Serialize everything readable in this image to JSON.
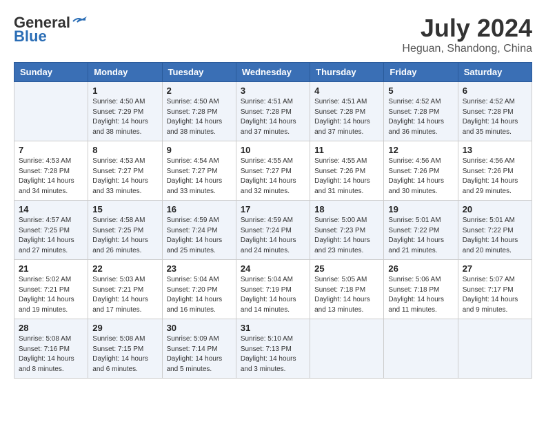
{
  "header": {
    "logo_line1": "General",
    "logo_line2": "Blue",
    "month_year": "July 2024",
    "location": "Heguan, Shandong, China"
  },
  "weekdays": [
    "Sunday",
    "Monday",
    "Tuesday",
    "Wednesday",
    "Thursday",
    "Friday",
    "Saturday"
  ],
  "weeks": [
    [
      {
        "day": "",
        "info": ""
      },
      {
        "day": "1",
        "info": "Sunrise: 4:50 AM\nSunset: 7:29 PM\nDaylight: 14 hours\nand 38 minutes."
      },
      {
        "day": "2",
        "info": "Sunrise: 4:50 AM\nSunset: 7:28 PM\nDaylight: 14 hours\nand 38 minutes."
      },
      {
        "day": "3",
        "info": "Sunrise: 4:51 AM\nSunset: 7:28 PM\nDaylight: 14 hours\nand 37 minutes."
      },
      {
        "day": "4",
        "info": "Sunrise: 4:51 AM\nSunset: 7:28 PM\nDaylight: 14 hours\nand 37 minutes."
      },
      {
        "day": "5",
        "info": "Sunrise: 4:52 AM\nSunset: 7:28 PM\nDaylight: 14 hours\nand 36 minutes."
      },
      {
        "day": "6",
        "info": "Sunrise: 4:52 AM\nSunset: 7:28 PM\nDaylight: 14 hours\nand 35 minutes."
      }
    ],
    [
      {
        "day": "7",
        "info": "Sunrise: 4:53 AM\nSunset: 7:28 PM\nDaylight: 14 hours\nand 34 minutes."
      },
      {
        "day": "8",
        "info": "Sunrise: 4:53 AM\nSunset: 7:27 PM\nDaylight: 14 hours\nand 33 minutes."
      },
      {
        "day": "9",
        "info": "Sunrise: 4:54 AM\nSunset: 7:27 PM\nDaylight: 14 hours\nand 33 minutes."
      },
      {
        "day": "10",
        "info": "Sunrise: 4:55 AM\nSunset: 7:27 PM\nDaylight: 14 hours\nand 32 minutes."
      },
      {
        "day": "11",
        "info": "Sunrise: 4:55 AM\nSunset: 7:26 PM\nDaylight: 14 hours\nand 31 minutes."
      },
      {
        "day": "12",
        "info": "Sunrise: 4:56 AM\nSunset: 7:26 PM\nDaylight: 14 hours\nand 30 minutes."
      },
      {
        "day": "13",
        "info": "Sunrise: 4:56 AM\nSunset: 7:26 PM\nDaylight: 14 hours\nand 29 minutes."
      }
    ],
    [
      {
        "day": "14",
        "info": "Sunrise: 4:57 AM\nSunset: 7:25 PM\nDaylight: 14 hours\nand 27 minutes."
      },
      {
        "day": "15",
        "info": "Sunrise: 4:58 AM\nSunset: 7:25 PM\nDaylight: 14 hours\nand 26 minutes."
      },
      {
        "day": "16",
        "info": "Sunrise: 4:59 AM\nSunset: 7:24 PM\nDaylight: 14 hours\nand 25 minutes."
      },
      {
        "day": "17",
        "info": "Sunrise: 4:59 AM\nSunset: 7:24 PM\nDaylight: 14 hours\nand 24 minutes."
      },
      {
        "day": "18",
        "info": "Sunrise: 5:00 AM\nSunset: 7:23 PM\nDaylight: 14 hours\nand 23 minutes."
      },
      {
        "day": "19",
        "info": "Sunrise: 5:01 AM\nSunset: 7:22 PM\nDaylight: 14 hours\nand 21 minutes."
      },
      {
        "day": "20",
        "info": "Sunrise: 5:01 AM\nSunset: 7:22 PM\nDaylight: 14 hours\nand 20 minutes."
      }
    ],
    [
      {
        "day": "21",
        "info": "Sunrise: 5:02 AM\nSunset: 7:21 PM\nDaylight: 14 hours\nand 19 minutes."
      },
      {
        "day": "22",
        "info": "Sunrise: 5:03 AM\nSunset: 7:21 PM\nDaylight: 14 hours\nand 17 minutes."
      },
      {
        "day": "23",
        "info": "Sunrise: 5:04 AM\nSunset: 7:20 PM\nDaylight: 14 hours\nand 16 minutes."
      },
      {
        "day": "24",
        "info": "Sunrise: 5:04 AM\nSunset: 7:19 PM\nDaylight: 14 hours\nand 14 minutes."
      },
      {
        "day": "25",
        "info": "Sunrise: 5:05 AM\nSunset: 7:18 PM\nDaylight: 14 hours\nand 13 minutes."
      },
      {
        "day": "26",
        "info": "Sunrise: 5:06 AM\nSunset: 7:18 PM\nDaylight: 14 hours\nand 11 minutes."
      },
      {
        "day": "27",
        "info": "Sunrise: 5:07 AM\nSunset: 7:17 PM\nDaylight: 14 hours\nand 9 minutes."
      }
    ],
    [
      {
        "day": "28",
        "info": "Sunrise: 5:08 AM\nSunset: 7:16 PM\nDaylight: 14 hours\nand 8 minutes."
      },
      {
        "day": "29",
        "info": "Sunrise: 5:08 AM\nSunset: 7:15 PM\nDaylight: 14 hours\nand 6 minutes."
      },
      {
        "day": "30",
        "info": "Sunrise: 5:09 AM\nSunset: 7:14 PM\nDaylight: 14 hours\nand 5 minutes."
      },
      {
        "day": "31",
        "info": "Sunrise: 5:10 AM\nSunset: 7:13 PM\nDaylight: 14 hours\nand 3 minutes."
      },
      {
        "day": "",
        "info": ""
      },
      {
        "day": "",
        "info": ""
      },
      {
        "day": "",
        "info": ""
      }
    ]
  ]
}
